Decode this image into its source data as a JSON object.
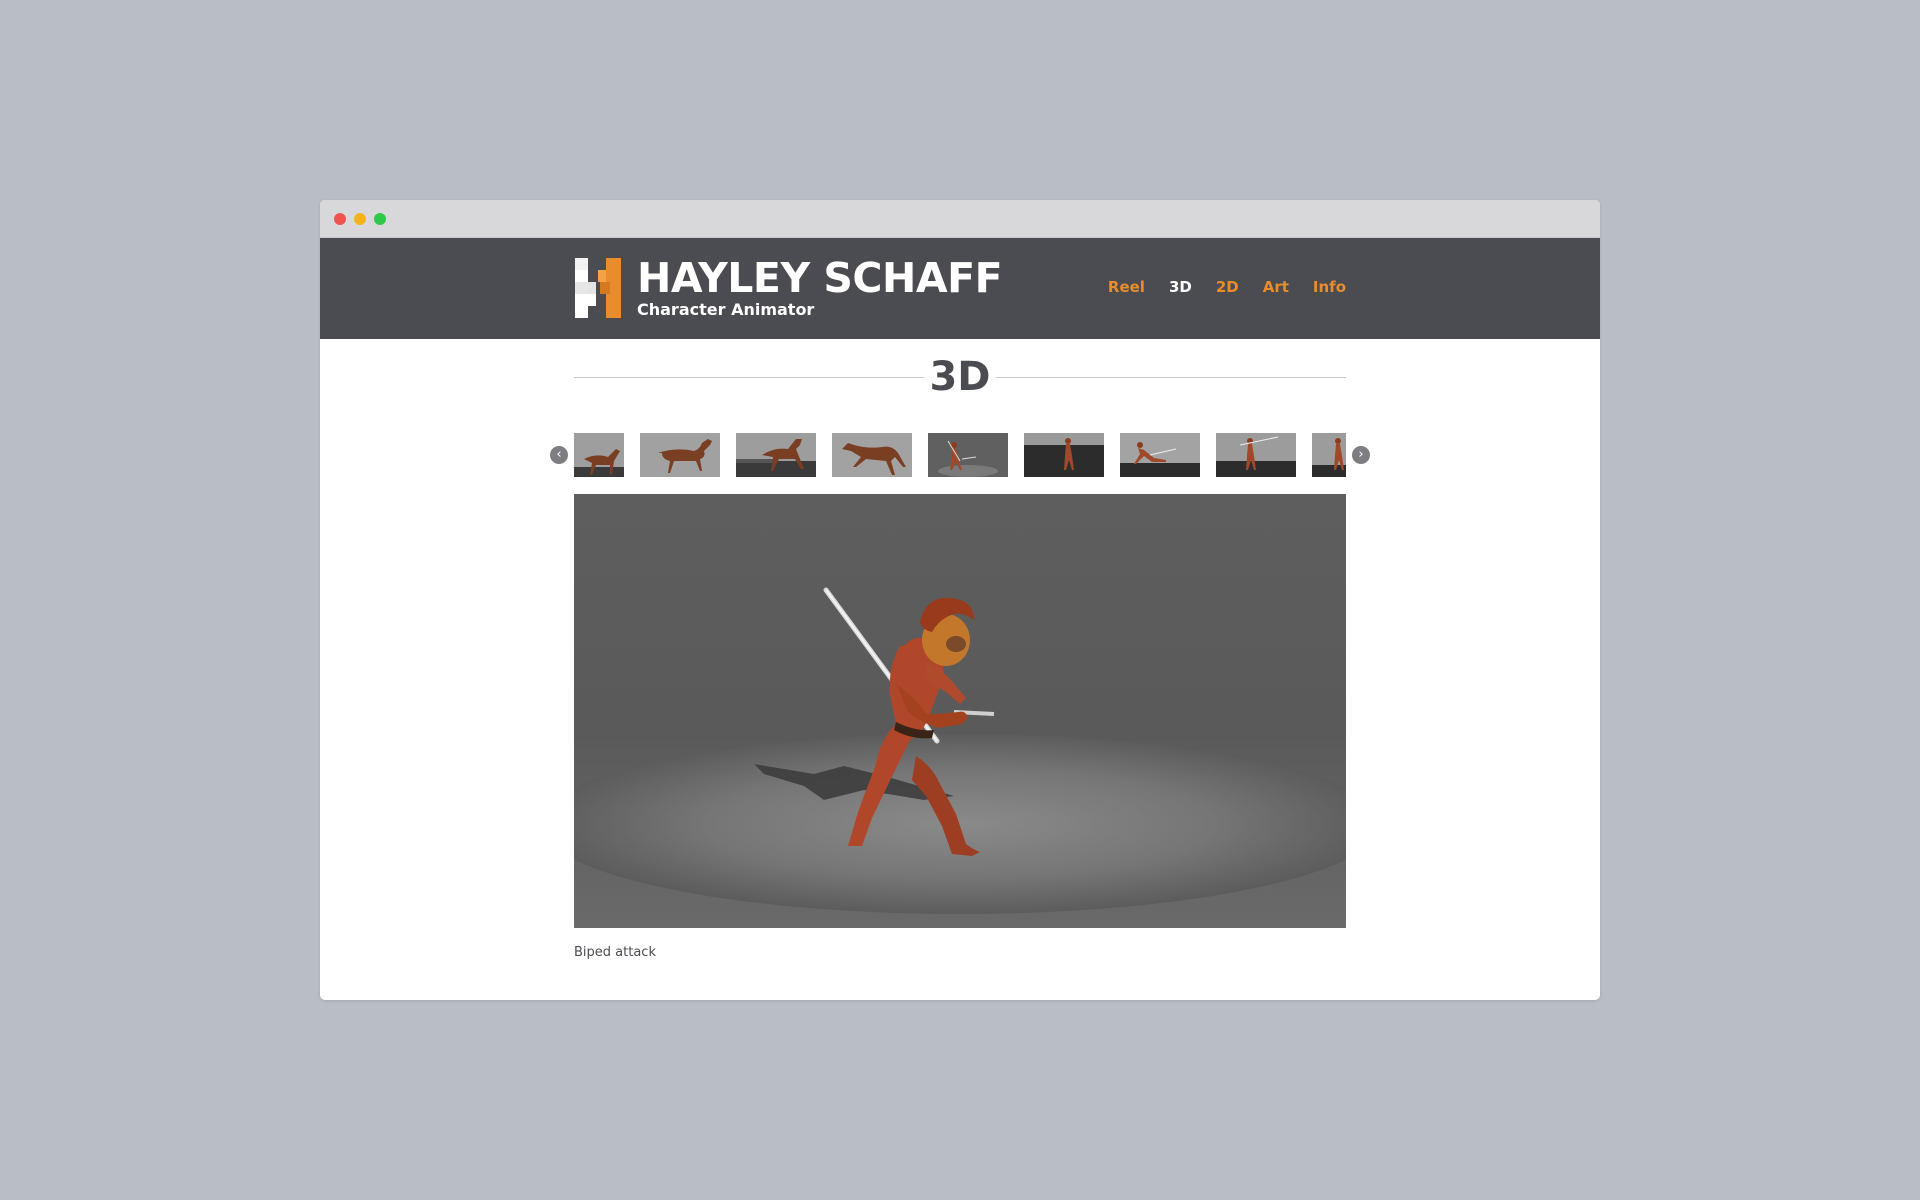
{
  "site": {
    "title": "HAYLEY SCHAFF",
    "subtitle": "Character Animator",
    "brand_orange": "#e88c2c",
    "header_bg": "#4b4c51"
  },
  "nav": {
    "items": [
      {
        "label": "Reel",
        "active": false
      },
      {
        "label": "3D",
        "active": true
      },
      {
        "label": "2D",
        "active": false
      },
      {
        "label": "Art",
        "active": false
      },
      {
        "label": "Info",
        "active": false
      }
    ]
  },
  "section": {
    "heading": "3D"
  },
  "carousel": {
    "prev_icon": "chevron-left-icon",
    "next_icon": "chevron-right-icon",
    "thumbnails": [
      {
        "subject": "horse-cropped"
      },
      {
        "subject": "horse-walk"
      },
      {
        "subject": "horse-jump-dark"
      },
      {
        "subject": "horse-leap"
      },
      {
        "subject": "biped-attack",
        "selected": true
      },
      {
        "subject": "biped-dark-floor"
      },
      {
        "subject": "biped-slide"
      },
      {
        "subject": "biped-spear"
      },
      {
        "subject": "biped-cropped"
      }
    ]
  },
  "viewer": {
    "caption": "Biped attack"
  }
}
